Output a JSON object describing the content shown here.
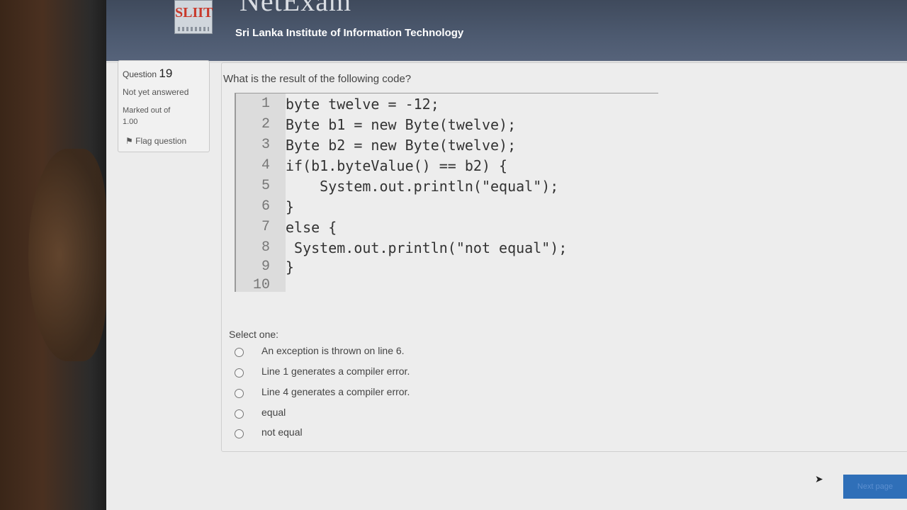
{
  "header": {
    "logo_text": "SLIIT",
    "app_title": "NetExam",
    "org_name": "Sri Lanka Institute of Information Technology"
  },
  "info": {
    "question_label": "Question",
    "question_number": "19",
    "state": "Not yet answered",
    "marked_out_of_label": "Marked out of",
    "marked_out_of_value": "1.00",
    "flag_label": "Flag question"
  },
  "question": {
    "prompt": "What is the result of the following code?",
    "code": [
      {
        "n": "1",
        "text": "byte twelve = -12;"
      },
      {
        "n": "2",
        "text": "Byte b1 = new Byte(twelve);"
      },
      {
        "n": "3",
        "text": "Byte b2 = new Byte(twelve);"
      },
      {
        "n": "4",
        "text": "if(b1.byteValue() == b2) {"
      },
      {
        "n": "5",
        "text": "    System.out.println(\"equal\");"
      },
      {
        "n": "6",
        "text": "}"
      },
      {
        "n": "7",
        "text": "else {"
      },
      {
        "n": "8",
        "text": " System.out.println(\"not equal\");"
      },
      {
        "n": "9",
        "text": "}"
      },
      {
        "n": "10",
        "text": ""
      }
    ],
    "select_label": "Select one:",
    "options": [
      "An exception is thrown on line 6.",
      "Line 1 generates a compiler error.",
      "Line 4 generates a compiler error.",
      "equal",
      "not equal"
    ]
  },
  "navigation": {
    "next_label": "Next page"
  }
}
